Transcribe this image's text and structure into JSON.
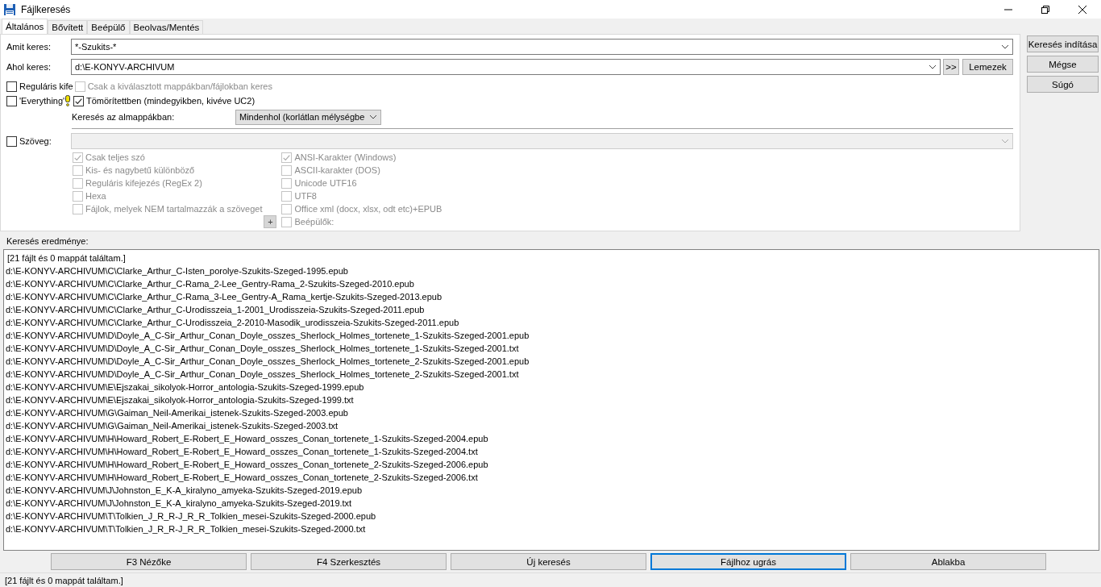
{
  "window": {
    "title": "Fájlkeresés"
  },
  "tabs": [
    {
      "label": "Általános",
      "selected": true
    },
    {
      "label": "Bővített",
      "selected": false
    },
    {
      "label": "Beépülő",
      "selected": false
    },
    {
      "label": "Beolvas/Mentés",
      "selected": false
    }
  ],
  "search_field": {
    "label": "Amit keres:",
    "value": "*-Szukits-*"
  },
  "location_field": {
    "label": "Ahol keres:",
    "value": "d:\\E-KONYV-ARCHIVUM",
    "browse_button": ">>",
    "drives_button": "Lemezek"
  },
  "option_rows": [
    [
      {
        "label": "Reguláris kife",
        "checked": false,
        "disabled": false
      },
      {
        "label": "Csak a kiválasztott mappákban/fájlokban keres",
        "checked": false,
        "disabled": true
      }
    ],
    [
      {
        "label": "'Everything'",
        "checked": false,
        "disabled": false
      },
      {
        "label": "Tömörítettben (mindegyikben, kivéve UC2)",
        "checked": true,
        "disabled": false
      }
    ]
  ],
  "subfolder_search": {
    "label": "Keresés az almappákban:",
    "value": "Mindenhol (korlátlan mélységbe"
  },
  "text_search": {
    "label": "Szöveg:",
    "checked": false,
    "disabled": true
  },
  "text_options_left": [
    {
      "label": "Csak teljes szó",
      "checked": true,
      "disabled": true
    },
    {
      "label": "Kis- és nagybetű különböző",
      "checked": false,
      "disabled": true
    },
    {
      "label": "Reguláris kifejezés (RegEx 2)",
      "checked": false,
      "disabled": true
    },
    {
      "label": "Hexa",
      "checked": false,
      "disabled": true
    },
    {
      "label": "Fájlok, melyek NEM tartalmazzák a szöveget",
      "checked": false,
      "disabled": true
    }
  ],
  "add_button": "+",
  "text_options_right": [
    {
      "label": "ANSI-Karakter (Windows)",
      "checked": true,
      "disabled": true
    },
    {
      "label": "ASCII-karakter (DOS)",
      "checked": false,
      "disabled": true
    },
    {
      "label": "Unicode UTF16",
      "checked": false,
      "disabled": true
    },
    {
      "label": "UTF8",
      "checked": false,
      "disabled": true
    },
    {
      "label": "Office xml (docx, xlsx, odt etc)+EPUB",
      "checked": false,
      "disabled": true
    },
    {
      "label": "Beépülők:",
      "checked": false,
      "disabled": true
    }
  ],
  "side_buttons": [
    "Keresés indítása",
    "Mégse",
    "Súgó"
  ],
  "results": {
    "label": "Keresés eredménye:",
    "lines": [
      "[21 fájlt és 0 mappát találtam.]",
      "d:\\E-KONYV-ARCHIVUM\\C\\Clarke_Arthur_C-Isten_porolye-Szukits-Szeged-1995.epub",
      "d:\\E-KONYV-ARCHIVUM\\C\\Clarke_Arthur_C-Rama_2-Lee_Gentry-Rama_2-Szukits-Szeged-2010.epub",
      "d:\\E-KONYV-ARCHIVUM\\C\\Clarke_Arthur_C-Rama_3-Lee_Gentry-A_Rama_kertje-Szukits-Szeged-2013.epub",
      "d:\\E-KONYV-ARCHIVUM\\C\\Clarke_Arthur_C-Urodisszeia_1-2001_Urodisszeia-Szukits-Szeged-2011.epub",
      "d:\\E-KONYV-ARCHIVUM\\C\\Clarke_Arthur_C-Urodisszeia_2-2010-Masodik_urodisszeia-Szukits-Szeged-2011.epub",
      "d:\\E-KONYV-ARCHIVUM\\D\\Doyle_A_C-Sir_Arthur_Conan_Doyle_osszes_Sherlock_Holmes_tortenete_1-Szukits-Szeged-2001.epub",
      "d:\\E-KONYV-ARCHIVUM\\D\\Doyle_A_C-Sir_Arthur_Conan_Doyle_osszes_Sherlock_Holmes_tortenete_1-Szukits-Szeged-2001.txt",
      "d:\\E-KONYV-ARCHIVUM\\D\\Doyle_A_C-Sir_Arthur_Conan_Doyle_osszes_Sherlock_Holmes_tortenete_2-Szukits-Szeged-2001.epub",
      "d:\\E-KONYV-ARCHIVUM\\D\\Doyle_A_C-Sir_Arthur_Conan_Doyle_osszes_Sherlock_Holmes_tortenete_2-Szukits-Szeged-2001.txt",
      "d:\\E-KONYV-ARCHIVUM\\E\\Ejszakai_sikolyok-Horror_antologia-Szukits-Szeged-1999.epub",
      "d:\\E-KONYV-ARCHIVUM\\E\\Ejszakai_sikolyok-Horror_antologia-Szukits-Szeged-1999.txt",
      "d:\\E-KONYV-ARCHIVUM\\G\\Gaiman_Neil-Amerikai_istenek-Szukits-Szeged-2003.epub",
      "d:\\E-KONYV-ARCHIVUM\\G\\Gaiman_Neil-Amerikai_istenek-Szukits-Szeged-2003.txt",
      "d:\\E-KONYV-ARCHIVUM\\H\\Howard_Robert_E-Robert_E_Howard_osszes_Conan_tortenete_1-Szukits-Szeged-2004.epub",
      "d:\\E-KONYV-ARCHIVUM\\H\\Howard_Robert_E-Robert_E_Howard_osszes_Conan_tortenete_1-Szukits-Szeged-2004.txt",
      "d:\\E-KONYV-ARCHIVUM\\H\\Howard_Robert_E-Robert_E_Howard_osszes_Conan_tortenete_2-Szukits-Szeged-2006.epub",
      "d:\\E-KONYV-ARCHIVUM\\H\\Howard_Robert_E-Robert_E_Howard_osszes_Conan_tortenete_2-Szukits-Szeged-2006.txt",
      "d:\\E-KONYV-ARCHIVUM\\J\\Johnston_E_K-A_kiralyno_amyeka-Szukits-Szeged-2019.epub",
      "d:\\E-KONYV-ARCHIVUM\\J\\Johnston_E_K-A_kiralyno_amyeka-Szukits-Szeged-2019.txt",
      "d:\\E-KONYV-ARCHIVUM\\T\\Tolkien_J_R_R-J_R_R_Tolkien_mesei-Szukits-Szeged-2000.epub",
      "d:\\E-KONYV-ARCHIVUM\\T\\Tolkien_J_R_R-J_R_R_Tolkien_mesei-Szukits-Szeged-2000.txt"
    ]
  },
  "bottom_buttons": [
    {
      "label": "F3 Nézőke",
      "focused": false
    },
    {
      "label": "F4 Szerkesztés",
      "focused": false
    },
    {
      "label": "Új keresés",
      "focused": false
    },
    {
      "label": "Fájlhoz ugrás",
      "focused": true
    },
    {
      "label": "Ablakba",
      "focused": false
    }
  ],
  "status_bar": "[21 fájlt és 0 mappát találtam.]"
}
